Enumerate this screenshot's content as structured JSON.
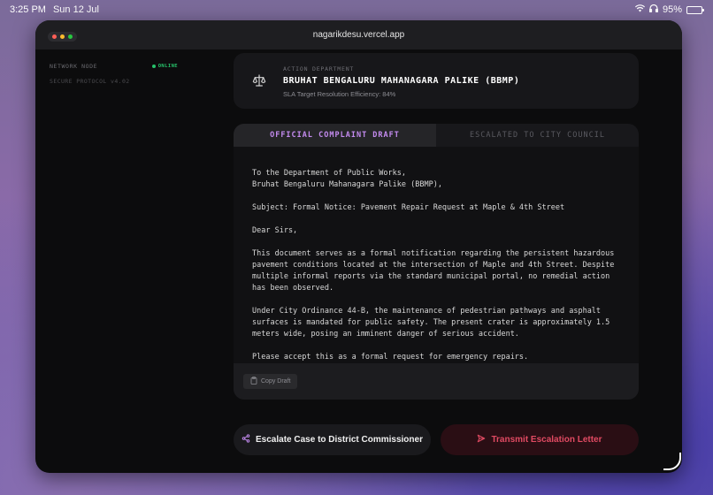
{
  "statusbar": {
    "time": "3:25 PM",
    "date": "Sun 12 Jul",
    "battery": "95%",
    "battery_level": 95
  },
  "window": {
    "url": "nagarikdesu.vercel.app"
  },
  "sidebar": {
    "node_label": "NETWORK NODE",
    "node_status": "ONLINE",
    "protocol": "SECURE PROTOCOL v4.02"
  },
  "department": {
    "label": "ACTION DEPARTMENT",
    "name": "BRUHAT BENGALURU MAHANAGARA PALIKE (BBMP)",
    "sla": "SLA Target Resolution Efficiency: 84%"
  },
  "tabs": [
    {
      "label": "OFFICIAL COMPLAINT DRAFT",
      "active": true
    },
    {
      "label": "ESCALATED TO CITY COUNCIL",
      "active": false
    }
  ],
  "letter": {
    "p1": "To the Department of Public Works,\nBruhat Bengaluru Mahanagara Palike (BBMP),",
    "p2": "Subject: Formal Notice: Pavement Repair Request at Maple & 4th Street",
    "p3": "Dear Sirs,",
    "p4": "This document serves as a formal notification regarding the persistent hazardous pavement conditions located at the intersection of Maple and 4th Street. Despite multiple informal reports via the standard municipal portal, no remedial action has been observed.",
    "p5": "Under City Ordinance 44-B, the maintenance of pedestrian pathways and asphalt surfaces is mandated for public safety. The present crater is approximately 1.5 meters wide, posing an imminent danger of serious accident.",
    "p6": "Please accept this as a formal request for emergency repairs."
  },
  "footer": {
    "copy_label": "Copy Draft"
  },
  "actions": {
    "escalate_label": "Escalate Case to District Commissioner",
    "transmit_label": "Transmit Escalation Letter"
  },
  "colors": {
    "accent_purple": "#c48bf0",
    "online_green": "#27c26a",
    "transmit_red": "#e04a62",
    "traffic_red": "#ff5f57",
    "traffic_yellow": "#febc2e",
    "traffic_green": "#28c840"
  },
  "icons": [
    "wifi-icon",
    "headphones-icon",
    "battery-icon",
    "scales-icon",
    "clipboard-icon",
    "share-icon",
    "send-icon"
  ]
}
